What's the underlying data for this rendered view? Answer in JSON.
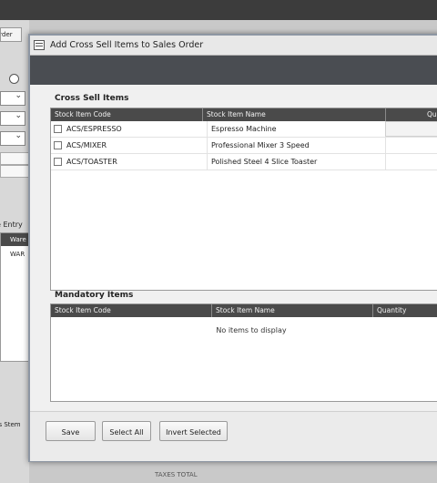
{
  "background": {
    "tab_label": "order",
    "entry_label": "e Entry",
    "grid_header": "Ware",
    "grid_cell": "WAR",
    "status_text": "ds Stem",
    "bottom_label": "TAXES TOTAL"
  },
  "dialog": {
    "title": "Add Cross Sell Items to Sales Order",
    "cross_sell": {
      "label": "Cross Sell Items",
      "columns": [
        "Stock Item Code",
        "Stock Item Name",
        "Qu"
      ],
      "rows": [
        {
          "code": "ACS/ESPRESSO",
          "name": "Espresso Machine",
          "checked": false
        },
        {
          "code": "ACS/MIXER",
          "name": "Professional Mixer 3 Speed",
          "checked": false
        },
        {
          "code": "ACS/TOASTER",
          "name": "Polished Steel 4 Slice Toaster",
          "checked": false
        }
      ]
    },
    "mandatory": {
      "label": "Mandatory Items",
      "columns": [
        "Stock Item Code",
        "Stock Item Name",
        "Quantity"
      ],
      "empty_message": "No items to display"
    },
    "buttons": {
      "save": "Save",
      "select_all": "Select All",
      "invert_selected": "Invert Selected"
    }
  }
}
